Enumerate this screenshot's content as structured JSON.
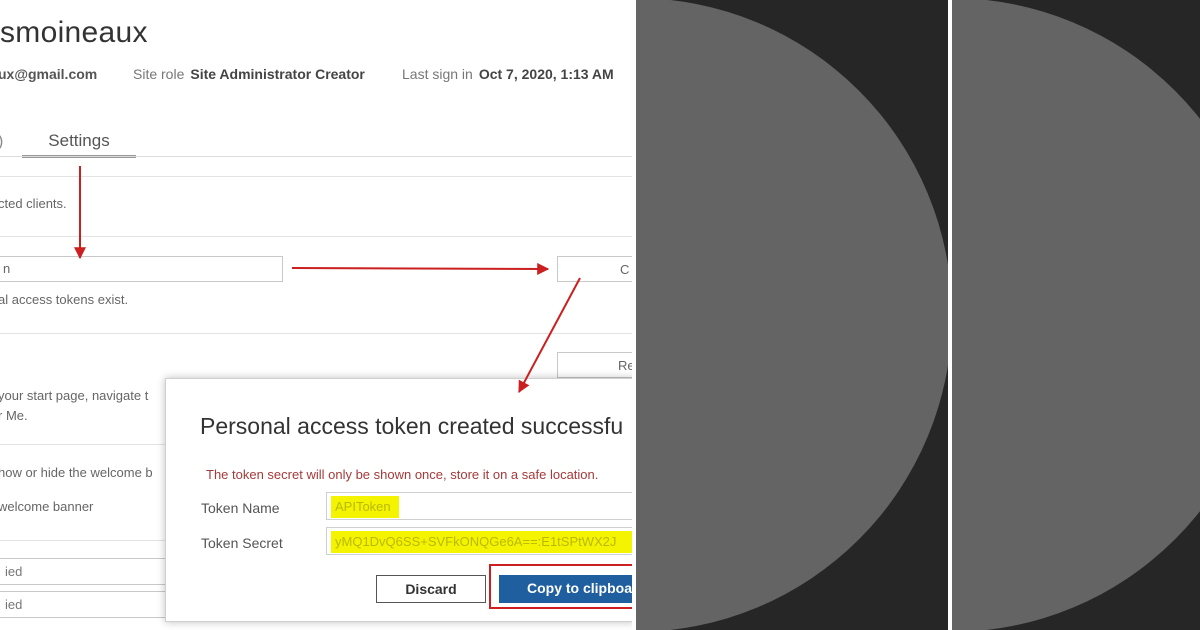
{
  "profile": {
    "name_fragment": "smoineaux",
    "email_fragment": "ux@gmail.com",
    "site_role_label": "Site role",
    "site_role_value": "Site Administrator Creator",
    "last_signin_label": "Last sign in",
    "last_signin_value": "Oct 7, 2020, 1:13 AM"
  },
  "tabs": {
    "previous_fragment": ")",
    "settings": "Settings"
  },
  "access_tokens": {
    "desc_fragment": "cted clients.",
    "name_input_value": "n",
    "create_button_fragment": "C",
    "status_fragment": "al access tokens exist."
  },
  "start_page": {
    "reset_button_fragment": "Re",
    "desc_line1": " your start page, navigate t",
    "desc_line2": "r Me."
  },
  "welcome": {
    "desc_fragment": "how or hide the welcome b",
    "option_fragment": "welcome banner"
  },
  "rows": [
    "ied",
    "ied"
  ],
  "dialog": {
    "title": "Personal access token created successfu",
    "warning": "The token secret will only be shown once, store it on a safe location.",
    "token_name_label": "Token Name",
    "token_name_value": "APIToken",
    "token_secret_label": "Token Secret",
    "token_secret_value": "yMQ1DvQ6SS+SVFkONQGe6A==:E1tSPtWX2J",
    "discard_label": "Discard",
    "copy_label": "Copy to clipboa"
  },
  "colors": {
    "annotation_red": "#cc1f1f",
    "highlight_yellow": "#f4f400",
    "primary_blue": "#1f5f9f",
    "panel_dark": "#262626",
    "circle_gray": "#646464"
  }
}
